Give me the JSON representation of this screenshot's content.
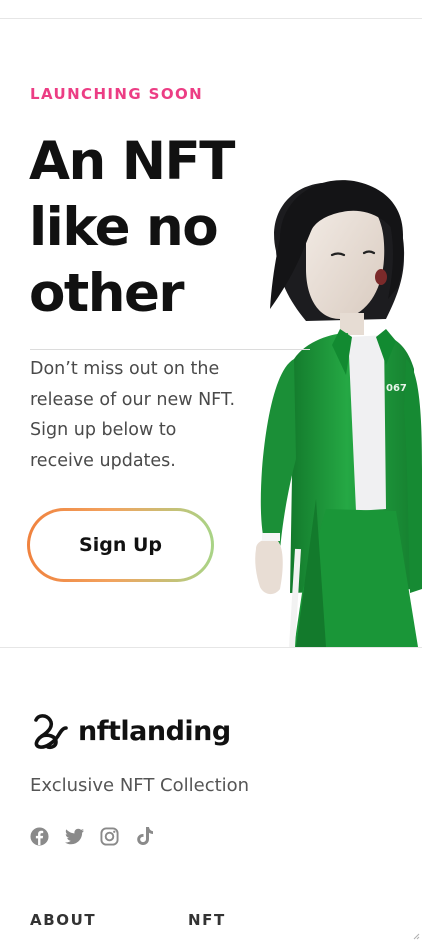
{
  "hero": {
    "eyebrow": "LAUNCHING SOON",
    "headline": [
      "An NFT",
      "like no",
      "other"
    ],
    "blurb": "Don’t miss out on the release of our new NFT. Sign up below to receive updates.",
    "cta_label": "Sign Up",
    "figure_badge": "067"
  },
  "footer": {
    "brand_name": "nftlanding",
    "tagline": "Exclusive NFT Collection",
    "social_icons": [
      "facebook-icon",
      "twitter-icon",
      "instagram-icon",
      "tiktok-icon"
    ],
    "columns": [
      {
        "title": "ABOUT"
      },
      {
        "title": "NFT"
      }
    ]
  },
  "colors": {
    "accent": "#ec3d84",
    "button_gradient_start": "#f0823e",
    "button_gradient_end": "#a8d487",
    "jacket_green": "#1f9a3c",
    "social_icon": "#8a8a8a"
  }
}
